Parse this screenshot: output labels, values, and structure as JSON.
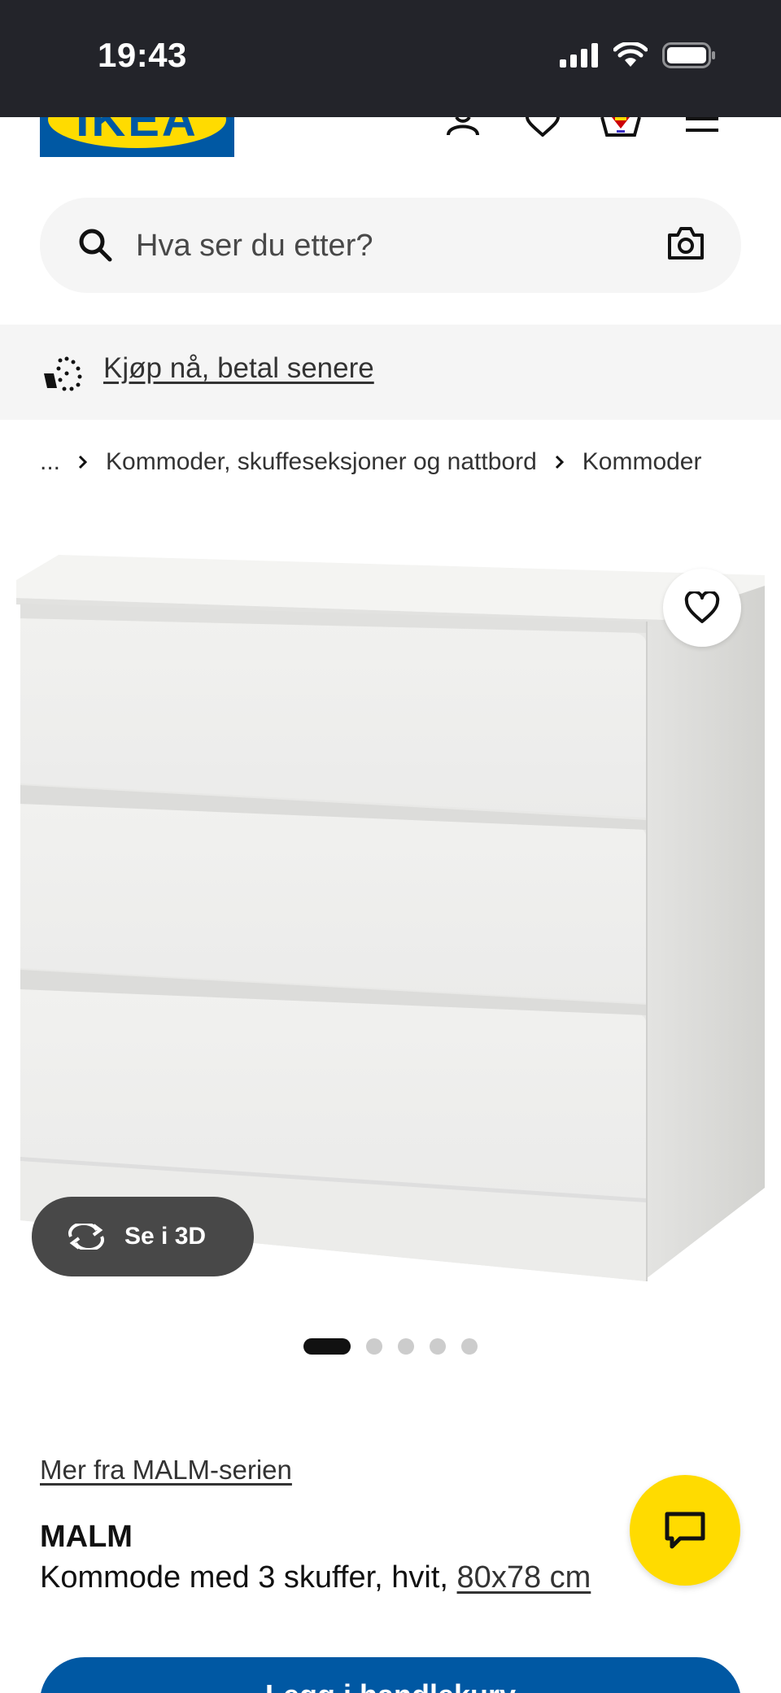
{
  "status_bar": {
    "time": "19:43",
    "icons": [
      "cellular-signal-icon",
      "wifi-icon",
      "battery-icon"
    ]
  },
  "header": {
    "logo_text": "IKEA",
    "icons": [
      "user-icon",
      "heart-icon",
      "basket-icon",
      "menu-icon"
    ]
  },
  "search": {
    "placeholder": "Hva ser du etter?",
    "value": ""
  },
  "promo": {
    "label": "Kjøp nå, betal senere"
  },
  "breadcrumb": {
    "items": [
      "...",
      "Kommoder, skuffeseksjoner og nattbord",
      "Kommoder"
    ]
  },
  "gallery": {
    "view3d_label": "Se i 3D",
    "slide_count": 5,
    "active_slide": 1
  },
  "product": {
    "series_link": "Mer fra MALM-serien",
    "name": "MALM",
    "description": "Kommode med 3 skuffer, hvit, ",
    "size": "80x78 cm"
  },
  "cta": {
    "buy_label": "Legg i handlekurv"
  },
  "colors": {
    "brand_blue": "#0058a3",
    "brand_yellow": "#ffdb00",
    "status_bar": "#23242a"
  }
}
